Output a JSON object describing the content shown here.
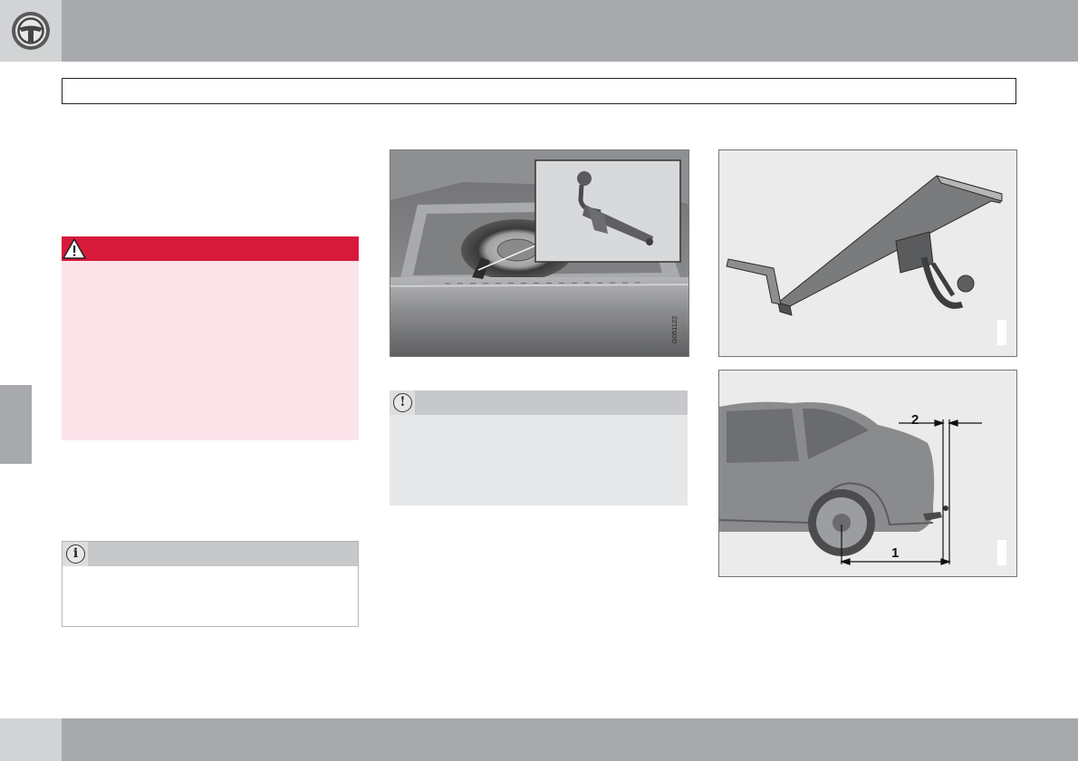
{
  "header": {
    "icon": "steering-wheel-icon"
  },
  "colors": {
    "band": "#a7a9ac",
    "corner": "#d1d3d4",
    "warning_red": "#d71a3a",
    "warning_body": "#fbe3ea",
    "note_header": "#c7c8ca",
    "caution_body": "#e6e7e8"
  },
  "warning": {
    "icon": "warning-triangle-icon"
  },
  "note": {
    "icon": "info-icon",
    "symbol": "i"
  },
  "caution": {
    "icon": "exclamation-icon",
    "symbol": "!"
  },
  "figures": {
    "trunk": {
      "code": "G051122"
    },
    "dimensions": {
      "label_2": "2",
      "label_1": "1"
    }
  }
}
